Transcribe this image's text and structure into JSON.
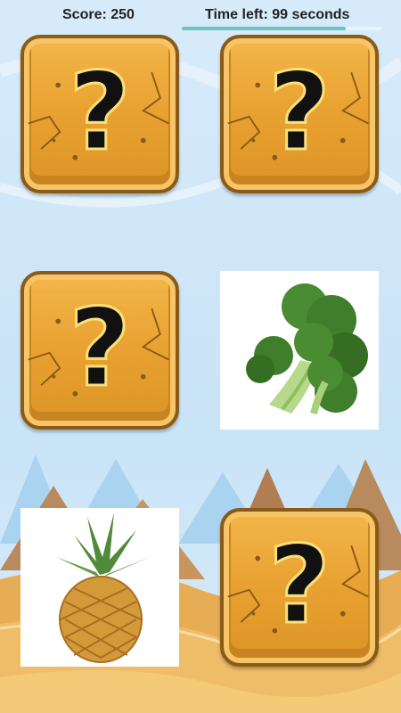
{
  "hud": {
    "score_text": "Score: 250",
    "time_text": "Time left: 99 seconds",
    "time_fraction": 0.82
  },
  "cards": [
    {
      "state": "hidden",
      "symbol": "?"
    },
    {
      "state": "hidden",
      "symbol": "?"
    },
    {
      "state": "hidden",
      "symbol": "?"
    },
    {
      "state": "revealed",
      "image": "broccoli"
    },
    {
      "state": "revealed",
      "image": "pineapple"
    },
    {
      "state": "hidden",
      "symbol": "?"
    }
  ],
  "colors": {
    "sky": "#cfe6f8",
    "card_orange": "#e9a332",
    "card_border": "#8a5a18",
    "timer_bar": "#6cc3bf"
  }
}
